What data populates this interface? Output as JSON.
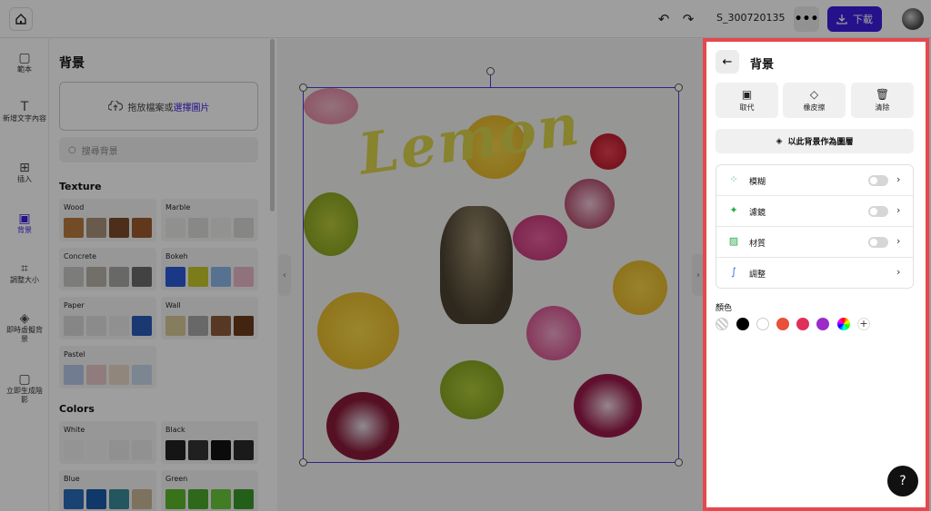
{
  "topbar": {
    "filename": "S_300720135",
    "download_label": "下載",
    "more_label": "•••"
  },
  "rail": [
    {
      "label": "範本",
      "icon": "template-icon"
    },
    {
      "label": "新增文字內容",
      "icon": "text-icon"
    },
    {
      "label": "插入",
      "icon": "insert-image-icon"
    },
    {
      "label": "背景",
      "icon": "background-icon"
    },
    {
      "label": "調整大小",
      "icon": "crop-icon"
    },
    {
      "label": "即時虛擬背景",
      "icon": "layers-icon"
    },
    {
      "label": "立即生成陰影",
      "icon": "shadow-icon"
    }
  ],
  "panel": {
    "title": "背景",
    "upload_text": "拖放檔案或",
    "upload_link": "選擇圖片",
    "search_placeholder": "搜尋背景",
    "texture_title": "Texture",
    "colors_title": "Colors",
    "textures": [
      {
        "name": "Wood",
        "swatches": [
          "#b87a3d",
          "#a8927a",
          "#7a4a2a",
          "#9c5a2c"
        ]
      },
      {
        "name": "Marble",
        "swatches": [
          "#e8e8e6",
          "#dcdcda",
          "#ececea",
          "#d8d8d6"
        ]
      },
      {
        "name": "Concrete",
        "swatches": [
          "#c8c8c6",
          "#b8b2a8",
          "#a8a8a6",
          "#6a6a6a"
        ]
      },
      {
        "name": "Bokeh",
        "swatches": [
          "#2a5ad8",
          "#c8c82a",
          "#8ab8e8",
          "#e8b8c8"
        ]
      },
      {
        "name": "Paper",
        "swatches": [
          "#d8d8d8",
          "#e0e0e0",
          "#e8e8e8",
          "#2a5ab8"
        ]
      },
      {
        "name": "Wall",
        "swatches": [
          "#d8c898",
          "#a8a8a8",
          "#8a5a3a",
          "#6a3a1a"
        ]
      },
      {
        "name": "Pastel",
        "swatches": [
          "#b8c8e8",
          "#e8c8c8",
          "#e8d8c8",
          "#c8d8e8"
        ]
      }
    ],
    "colors": [
      {
        "name": "White",
        "swatches": [
          "#eeeeee",
          "#f2f2f2",
          "#e8e8e8",
          "#eaeaea"
        ]
      },
      {
        "name": "Black",
        "swatches": [
          "#222222",
          "#333333",
          "#111111",
          "#2a2a2a"
        ]
      },
      {
        "name": "Blue",
        "swatches": [
          "#2a6ab8",
          "#1a5aa8",
          "#3a8a9a",
          "#c8b898"
        ]
      },
      {
        "name": "Green",
        "swatches": [
          "#5ab82a",
          "#4aa82a",
          "#6ac83a",
          "#3a9a2a"
        ]
      }
    ]
  },
  "canvas": {
    "text": "Lemon"
  },
  "right_panel": {
    "title": "背景",
    "actions": [
      {
        "label": "取代",
        "icon": "image-icon"
      },
      {
        "label": "橡皮擦",
        "icon": "eraser-icon"
      },
      {
        "label": "清除",
        "icon": "trash-icon"
      }
    ],
    "layer_button": "以此背景作為圖層",
    "options": [
      {
        "label": "模糊",
        "icon": "blur-icon",
        "toggle": false,
        "has_toggle": true
      },
      {
        "label": "濾鏡",
        "icon": "sparkle-icon",
        "toggle": false,
        "has_toggle": true
      },
      {
        "label": "材質",
        "icon": "texture-icon",
        "toggle": false,
        "has_toggle": true
      },
      {
        "label": "調整",
        "icon": "adjust-icon",
        "has_toggle": false
      }
    ],
    "color_label": "顏色",
    "colors": [
      "transparent",
      "#000000",
      "#ffffff",
      "#e8503a",
      "#e0305a",
      "#9b2cc8",
      "rainbow"
    ],
    "add_label": "+"
  }
}
